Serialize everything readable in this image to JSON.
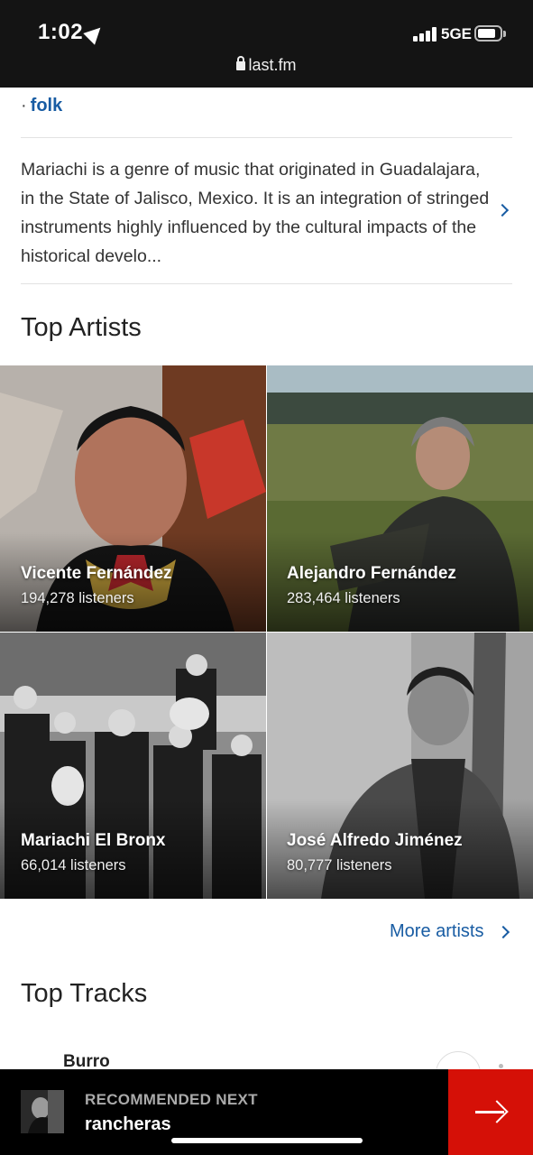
{
  "status_bar": {
    "time": "1:02",
    "network": "5GE",
    "url": "last.fm"
  },
  "tags": {
    "separator": "·",
    "last_tag": "folk"
  },
  "wiki": {
    "summary": "Mariachi is a genre of music that originated in Guadalajara, in the State of Jalisco, Mexico. It is an integration of stringed instruments highly influenced by the cultural impacts of the historical develo..."
  },
  "top_artists": {
    "title": "Top Artists",
    "artists": [
      {
        "name": "Vicente Fernández",
        "listeners": "194,278 listeners"
      },
      {
        "name": "Alejandro Fernández",
        "listeners": "283,464 listeners"
      },
      {
        "name": "Mariachi El Bronx",
        "listeners": "66,014 listeners"
      },
      {
        "name": "José Alfredo Jiménez",
        "listeners": "80,777 listeners"
      }
    ],
    "more_label": "More artists"
  },
  "top_tracks": {
    "title": "Top Tracks",
    "tracks": [
      {
        "name": "Burro"
      }
    ]
  },
  "recommended": {
    "label": "RECOMMENDED NEXT",
    "tag": "rancheras"
  },
  "colors": {
    "link": "#185ca3",
    "accent": "#d51007",
    "status_bar_bg": "#141414"
  }
}
